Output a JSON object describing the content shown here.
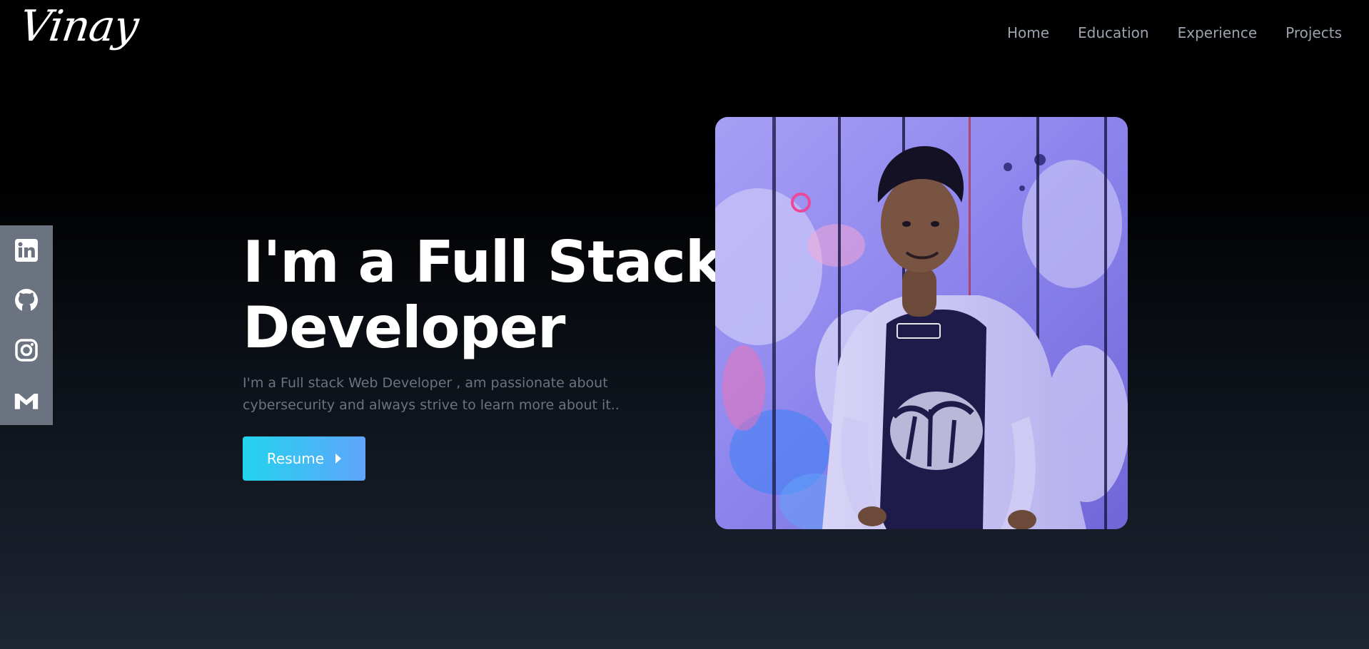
{
  "brand": {
    "logo_text": "Vinay"
  },
  "nav": {
    "items": [
      {
        "label": "Home"
      },
      {
        "label": "Education"
      },
      {
        "label": "Experience"
      },
      {
        "label": "Projects"
      }
    ]
  },
  "social": {
    "icons": [
      "linkedin-icon",
      "github-icon",
      "instagram-icon",
      "gmail-icon"
    ],
    "color": "#ffffff",
    "panel_color": "#6b7280"
  },
  "hero": {
    "title": "I'm a Full Stack Developer",
    "description": "I'm a Full stack Web Developer , am passionate about cybersecurity and always strive to learn more about it..",
    "resume_label": "Resume"
  },
  "colors": {
    "accent_start": "#22d3ee",
    "accent_end": "#60a5fa",
    "muted_text": "#6b7280",
    "nav_text": "#9ca3af"
  }
}
